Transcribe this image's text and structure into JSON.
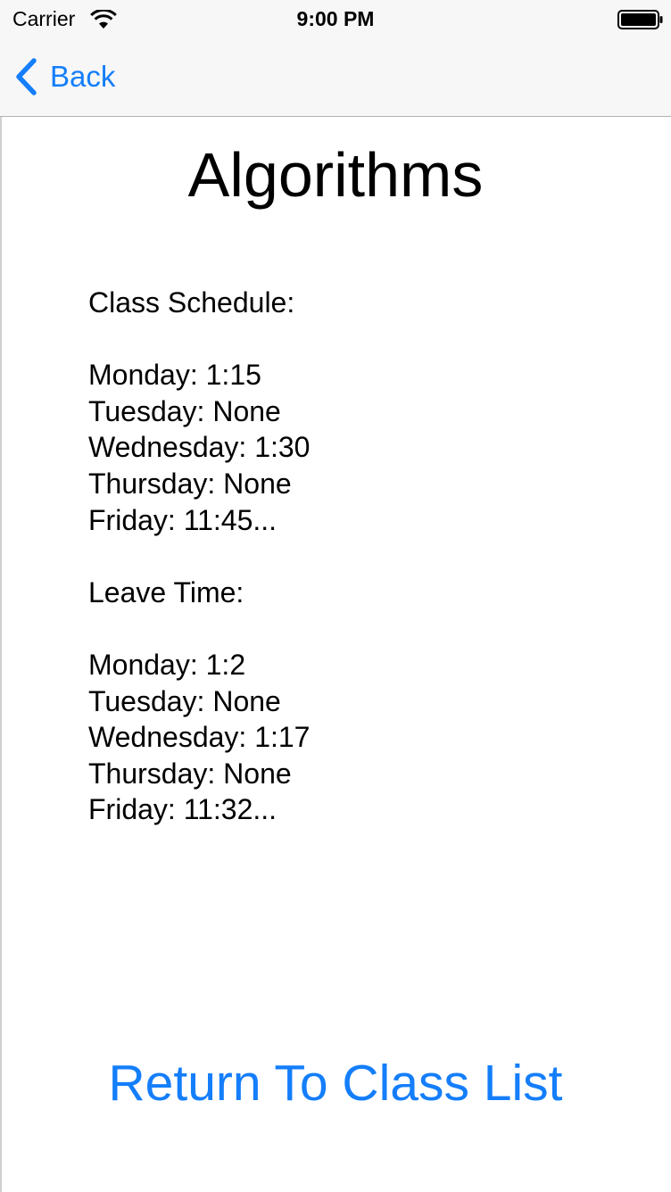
{
  "status_bar": {
    "carrier": "Carrier",
    "time": "9:00 PM",
    "wifi_icon": "wifi-icon",
    "battery_icon": "battery-icon"
  },
  "nav": {
    "back_label": "Back",
    "back_icon": "chevron-left-icon",
    "accent_color": "#147efb"
  },
  "page": {
    "title": "Algorithms"
  },
  "schedule": {
    "header": "Class Schedule:",
    "days": [
      "Monday: 1:15",
      "Tuesday: None",
      "Wednesday: 1:30",
      "Thursday: None",
      "Friday: 11:45..."
    ]
  },
  "leave": {
    "header": "Leave Time:",
    "days": [
      "Monday: 1:2",
      "Tuesday: None",
      "Wednesday: 1:17",
      "Thursday: None",
      "Friday: 11:32..."
    ]
  },
  "footer": {
    "return_label": "Return To Class List"
  }
}
